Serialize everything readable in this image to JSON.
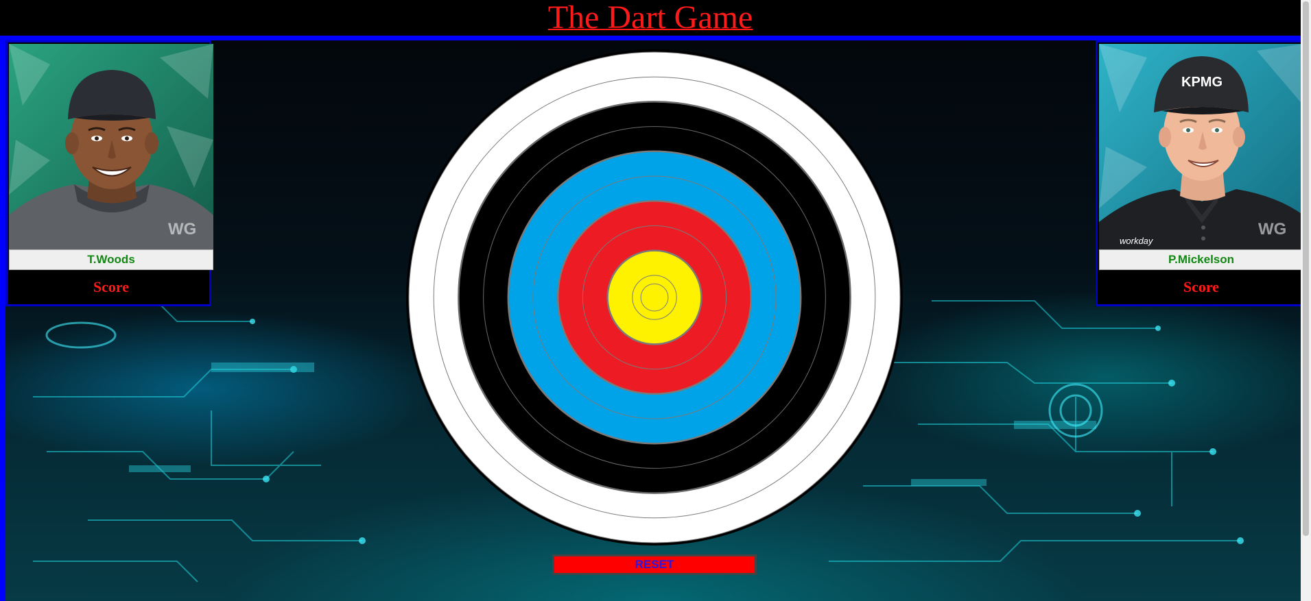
{
  "header": {
    "title": "The Dart Game"
  },
  "players": {
    "left": {
      "name": "T.Woods",
      "score_label": "Score",
      "watermark": "WG",
      "portrait_bg": "#1e7d66"
    },
    "right": {
      "name": "P.Mickelson",
      "score_label": "Score",
      "watermark": "WG",
      "portrait_bg": "#1a8aa0",
      "cap_logo": "KPMG",
      "shirt_logo": "workday"
    }
  },
  "target": {
    "rings": [
      "white",
      "white",
      "black",
      "black",
      "blue",
      "blue",
      "red",
      "red",
      "yellow",
      "yellow"
    ],
    "colors": {
      "white": "#ffffff",
      "black": "#000000",
      "blue": "#00a2e8",
      "red": "#ed1c24",
      "yellow": "#fff200"
    }
  },
  "controls": {
    "reset_label": "RESET"
  },
  "theme": {
    "accent_blue": "#0000ff",
    "title_red": "#ff1a1a",
    "name_green": "#118811"
  }
}
